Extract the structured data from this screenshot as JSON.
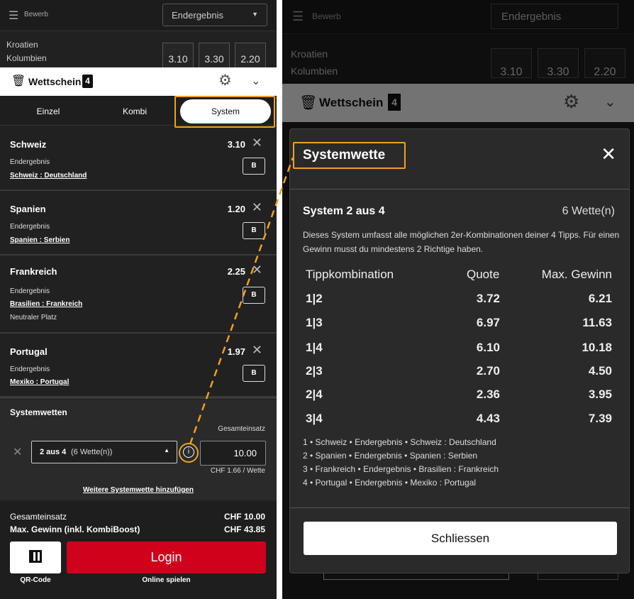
{
  "top": {
    "filter_label": "Bewerb",
    "market_select": "Endergebnis"
  },
  "event": {
    "home": "Kroatien",
    "away": "Kolumbien",
    "odds": [
      "3.10",
      "3.30",
      "2.20"
    ]
  },
  "betslip": {
    "title": "Wettschein",
    "count": "4"
  },
  "tabs": [
    {
      "label": "Einzel"
    },
    {
      "label": "Kombi"
    },
    {
      "label": "System"
    }
  ],
  "legs": [
    {
      "team": "Schweiz",
      "odds": "3.10",
      "market": "Endergebnis",
      "match": "Schweiz : Deutschland",
      "extra": "",
      "banker": "B"
    },
    {
      "team": "Spanien",
      "odds": "1.20",
      "market": "Endergebnis",
      "match": "Spanien : Serbien",
      "extra": "",
      "banker": "B"
    },
    {
      "team": "Frankreich",
      "odds": "2.25",
      "market": "Endergebnis",
      "match": "Brasilien : Frankreich",
      "extra": "Neutraler Platz",
      "banker": "B"
    },
    {
      "team": "Portugal",
      "odds": "1.97",
      "market": "Endergebnis",
      "match": "Mexiko : Portugal",
      "extra": "",
      "banker": "B"
    }
  ],
  "systems": {
    "title": "Systemwetten",
    "stake_label": "Gesamteinsatz",
    "system_select": "2 aus 4",
    "system_select_sub": "(6 Wette(n))",
    "stake_value": "10.00",
    "per_bet": "CHF 1.66 / Wette",
    "add_more": "Weitere Systemwette hinzufügen"
  },
  "summary": {
    "total_label": "Gesamteinsatz",
    "total_value": "CHF 10.00",
    "max_label": "Max. Gewinn (inkl. KombiBoost)",
    "max_value": "CHF 43.85"
  },
  "actions": {
    "qr_label": "QR-Code",
    "login": "Login",
    "online_label": "Online spielen"
  },
  "modal": {
    "title": "Systemwette",
    "system_name": "System 2 aus 4",
    "bets_count": "6 Wette(n)",
    "description": "Dieses System umfasst alle möglichen 2er-Kombinationen deiner 4 Tipps. Für einen Gewinn musst du mindestens 2 Richtige haben.",
    "col_combo": "Tippkombination",
    "col_odds": "Quote",
    "col_win": "Max. Gewinn",
    "rows": [
      {
        "combo": "1|2",
        "odds": "3.72",
        "win": "6.21"
      },
      {
        "combo": "1|3",
        "odds": "6.97",
        "win": "11.63"
      },
      {
        "combo": "1|4",
        "odds": "6.10",
        "win": "10.18"
      },
      {
        "combo": "2|3",
        "odds": "2.70",
        "win": "4.50"
      },
      {
        "combo": "2|4",
        "odds": "2.36",
        "win": "3.95"
      },
      {
        "combo": "3|4",
        "odds": "4.43",
        "win": "7.39"
      }
    ],
    "legend": [
      "1 • Schweiz • Endergebnis • Schweiz : Deutschland",
      "2 • Spanien • Endergebnis • Spanien : Serbien",
      "3 • Frankreich • Endergebnis • Brasilien : Frankreich",
      "4 • Portugal • Endergebnis • Mexiko : Portugal"
    ],
    "close_button": "Schliessen"
  },
  "colors": {
    "accent": "#f0a020",
    "login": "#d0021b",
    "bg": "#212121"
  }
}
